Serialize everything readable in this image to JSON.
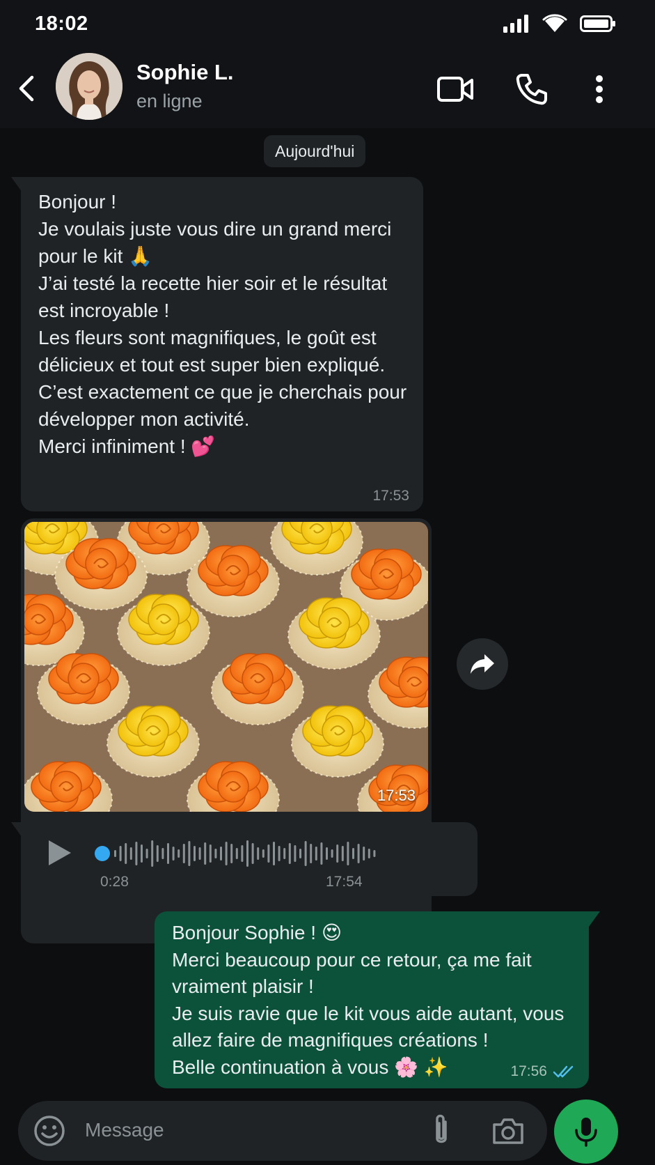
{
  "status_bar": {
    "time": "18:02"
  },
  "header": {
    "contact_name": "Sophie L.",
    "contact_status": "en ligne",
    "icons": [
      "back-arrow-icon",
      "video-call-icon",
      "phone-call-icon",
      "more-options-icon"
    ]
  },
  "chat": {
    "date_label": "Aujourd'hui",
    "messages": [
      {
        "direction": "incoming",
        "type": "text",
        "text": "Bonjour !\nJe voulais juste vous dire un grand merci pour le kit 🙏\nJ’ai testé la recette hier soir et le résultat est incroyable !\nLes fleurs sont magnifiques, le goût est délicieux et tout est super bien expliqué.\nC’est exactement ce que je cherchais pour développer mon activité.\nMerci infiniment ! 💕",
        "time": "17:53"
      },
      {
        "direction": "incoming",
        "type": "image",
        "time": "17:53"
      },
      {
        "direction": "incoming",
        "type": "audio",
        "duration": "0:28",
        "time": "17:54"
      },
      {
        "direction": "outgoing",
        "type": "text",
        "text": "Bonjour Sophie ! 😍\nMerci beaucoup pour ce retour, ça me fait vraiment plaisir !\nJe suis ravie que le kit vous aide autant, vous allez faire de magnifiques créations !\nBelle continuation à vous 🌸 ✨",
        "time": "17:56",
        "read_receipt": "double-check-icon"
      }
    ]
  },
  "input": {
    "placeholder": "Message"
  },
  "colors": {
    "background": "#0d0e10",
    "incoming_bubble": "#202326",
    "outgoing_bubble": "#0c5139",
    "accent_green": "#1fa855",
    "audio_dot": "#34a8f0",
    "read_check": "#53bdeb"
  }
}
